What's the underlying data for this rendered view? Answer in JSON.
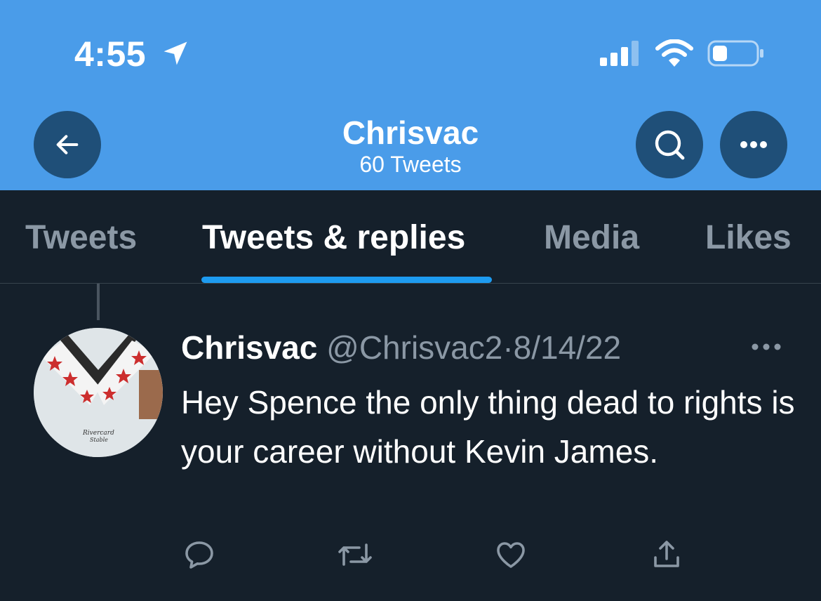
{
  "status_bar": {
    "time": "4:55",
    "icons": [
      "location-arrow-icon",
      "cellular-signal-icon",
      "wifi-icon",
      "battery-icon"
    ]
  },
  "header": {
    "name": "Chrisvac",
    "tweet_count": "60 Tweets",
    "background": "#4a9ce9",
    "buttons": [
      "back-arrow-icon",
      "search-icon",
      "more-icon"
    ]
  },
  "tabs": [
    {
      "label": "Tweets",
      "active": false
    },
    {
      "label": "Tweets & replies",
      "active": true
    },
    {
      "label": "Media",
      "active": false
    },
    {
      "label": "Likes",
      "active": false
    }
  ],
  "tweet": {
    "display_name": "Chrisvac",
    "handle": "@Chrisvac2",
    "separator": "·",
    "date": "8/14/22",
    "text": "Hey Spence the only thing dead to rights is your career without Kevin James.",
    "avatar_text": "Rivercard Stable",
    "actions": [
      "reply-icon",
      "retweet-icon",
      "like-icon",
      "share-icon"
    ]
  },
  "colors": {
    "accent": "#1d9bf0",
    "background": "#15202b",
    "muted_text": "#8b98a5"
  }
}
